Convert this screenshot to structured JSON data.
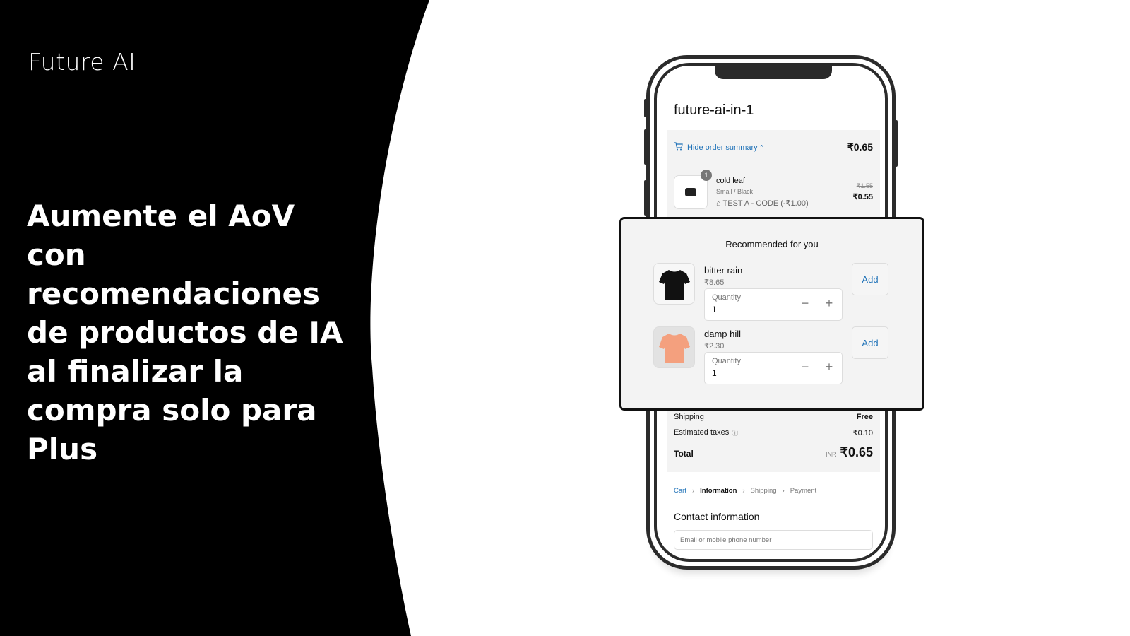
{
  "slide": {
    "brand": "Future AI",
    "headline": "Aumente el AoV con recomendaciones de productos de IA al finalizar la compra solo para Plus",
    "colors": {
      "left_panel": "#000000",
      "accent": "#1f72b8"
    }
  },
  "checkout": {
    "store_name": "future-ai-in-1",
    "summary_toggle": "Hide order summary",
    "summary_total": "₹0.65",
    "line_item": {
      "quantity": "1",
      "name": "cold leaf",
      "variant": "Small / Black",
      "discount": "TEST A - CODE (-₹1.00)",
      "original_price": "₹1.55",
      "price": "₹0.55"
    },
    "shipping_label": "Shipping",
    "shipping_value": "Free",
    "taxes_label": "Estimated taxes",
    "taxes_value": "₹0.10",
    "total_label": "Total",
    "currency": "INR",
    "total_value": "₹0.65",
    "breadcrumbs": [
      "Cart",
      "Information",
      "Shipping",
      "Payment"
    ],
    "contact_heading": "Contact information",
    "email_placeholder": "Email or mobile phone number"
  },
  "recommendations": {
    "title": "Recommended for you",
    "items": [
      {
        "name": "bitter rain",
        "price": "₹8.65",
        "quantity_label": "Quantity",
        "quantity": "1",
        "add_label": "Add",
        "image_color": "#111111"
      },
      {
        "name": "damp hill",
        "price": "₹2.30",
        "quantity_label": "Quantity",
        "quantity": "1",
        "add_label": "Add",
        "image_color": "#f4a07e"
      }
    ]
  }
}
